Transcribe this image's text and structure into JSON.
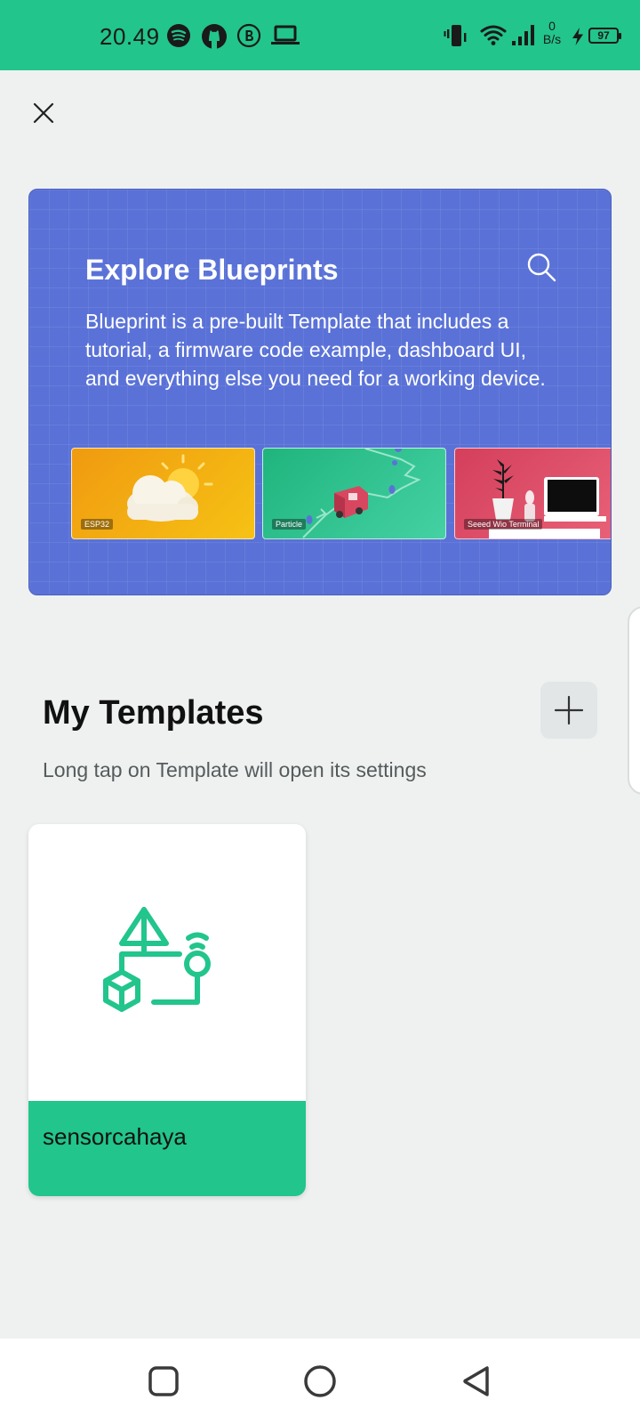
{
  "status_bar": {
    "time": "20.49",
    "net_speed_value": "0",
    "net_speed_unit": "B/s",
    "battery": "97",
    "icons": [
      "spotify-icon",
      "github-icon",
      "business-icon",
      "laptop-icon",
      "vibrate-icon",
      "wifi-icon",
      "signal-icon",
      "charging-icon"
    ]
  },
  "blueprints": {
    "title": "Explore Blueprints",
    "description": "Blueprint is a pre-built Template that includes a tutorial, a firmware code example, dashboard UI, and everything else you need for a working device.",
    "thumbnails": [
      {
        "tag": "ESP32"
      },
      {
        "tag": "Particle"
      },
      {
        "tag": "Seeed Wio Terminal"
      }
    ]
  },
  "templates": {
    "title": "My Templates",
    "hint": "Long tap on Template will open its settings",
    "items": [
      {
        "name": "sensorcahaya"
      }
    ]
  },
  "colors": {
    "accent": "#22c58c",
    "blueprint_bg": "#5a72d7",
    "page_bg": "#eff1f1"
  }
}
